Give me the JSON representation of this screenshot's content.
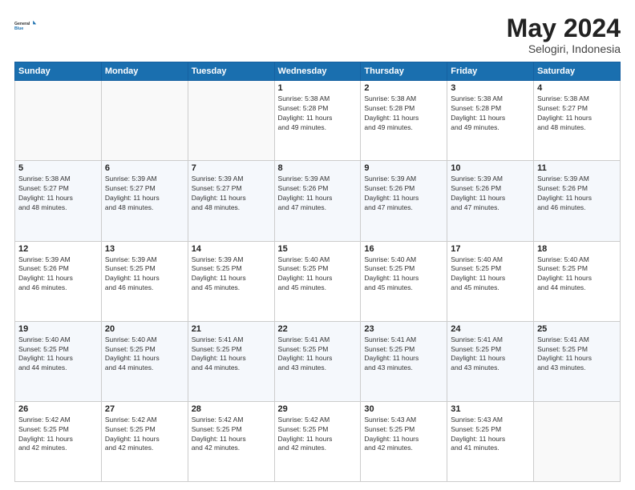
{
  "logo": {
    "line1": "General",
    "line2": "Blue"
  },
  "title": "May 2024",
  "subtitle": "Selogiri, Indonesia",
  "days_header": [
    "Sunday",
    "Monday",
    "Tuesday",
    "Wednesday",
    "Thursday",
    "Friday",
    "Saturday"
  ],
  "weeks": [
    [
      {
        "day": "",
        "content": ""
      },
      {
        "day": "",
        "content": ""
      },
      {
        "day": "",
        "content": ""
      },
      {
        "day": "1",
        "content": "Sunrise: 5:38 AM\nSunset: 5:28 PM\nDaylight: 11 hours\nand 49 minutes."
      },
      {
        "day": "2",
        "content": "Sunrise: 5:38 AM\nSunset: 5:28 PM\nDaylight: 11 hours\nand 49 minutes."
      },
      {
        "day": "3",
        "content": "Sunrise: 5:38 AM\nSunset: 5:28 PM\nDaylight: 11 hours\nand 49 minutes."
      },
      {
        "day": "4",
        "content": "Sunrise: 5:38 AM\nSunset: 5:27 PM\nDaylight: 11 hours\nand 48 minutes."
      }
    ],
    [
      {
        "day": "5",
        "content": "Sunrise: 5:38 AM\nSunset: 5:27 PM\nDaylight: 11 hours\nand 48 minutes."
      },
      {
        "day": "6",
        "content": "Sunrise: 5:39 AM\nSunset: 5:27 PM\nDaylight: 11 hours\nand 48 minutes."
      },
      {
        "day": "7",
        "content": "Sunrise: 5:39 AM\nSunset: 5:27 PM\nDaylight: 11 hours\nand 48 minutes."
      },
      {
        "day": "8",
        "content": "Sunrise: 5:39 AM\nSunset: 5:26 PM\nDaylight: 11 hours\nand 47 minutes."
      },
      {
        "day": "9",
        "content": "Sunrise: 5:39 AM\nSunset: 5:26 PM\nDaylight: 11 hours\nand 47 minutes."
      },
      {
        "day": "10",
        "content": "Sunrise: 5:39 AM\nSunset: 5:26 PM\nDaylight: 11 hours\nand 47 minutes."
      },
      {
        "day": "11",
        "content": "Sunrise: 5:39 AM\nSunset: 5:26 PM\nDaylight: 11 hours\nand 46 minutes."
      }
    ],
    [
      {
        "day": "12",
        "content": "Sunrise: 5:39 AM\nSunset: 5:26 PM\nDaylight: 11 hours\nand 46 minutes."
      },
      {
        "day": "13",
        "content": "Sunrise: 5:39 AM\nSunset: 5:25 PM\nDaylight: 11 hours\nand 46 minutes."
      },
      {
        "day": "14",
        "content": "Sunrise: 5:39 AM\nSunset: 5:25 PM\nDaylight: 11 hours\nand 45 minutes."
      },
      {
        "day": "15",
        "content": "Sunrise: 5:40 AM\nSunset: 5:25 PM\nDaylight: 11 hours\nand 45 minutes."
      },
      {
        "day": "16",
        "content": "Sunrise: 5:40 AM\nSunset: 5:25 PM\nDaylight: 11 hours\nand 45 minutes."
      },
      {
        "day": "17",
        "content": "Sunrise: 5:40 AM\nSunset: 5:25 PM\nDaylight: 11 hours\nand 45 minutes."
      },
      {
        "day": "18",
        "content": "Sunrise: 5:40 AM\nSunset: 5:25 PM\nDaylight: 11 hours\nand 44 minutes."
      }
    ],
    [
      {
        "day": "19",
        "content": "Sunrise: 5:40 AM\nSunset: 5:25 PM\nDaylight: 11 hours\nand 44 minutes."
      },
      {
        "day": "20",
        "content": "Sunrise: 5:40 AM\nSunset: 5:25 PM\nDaylight: 11 hours\nand 44 minutes."
      },
      {
        "day": "21",
        "content": "Sunrise: 5:41 AM\nSunset: 5:25 PM\nDaylight: 11 hours\nand 44 minutes."
      },
      {
        "day": "22",
        "content": "Sunrise: 5:41 AM\nSunset: 5:25 PM\nDaylight: 11 hours\nand 43 minutes."
      },
      {
        "day": "23",
        "content": "Sunrise: 5:41 AM\nSunset: 5:25 PM\nDaylight: 11 hours\nand 43 minutes."
      },
      {
        "day": "24",
        "content": "Sunrise: 5:41 AM\nSunset: 5:25 PM\nDaylight: 11 hours\nand 43 minutes."
      },
      {
        "day": "25",
        "content": "Sunrise: 5:41 AM\nSunset: 5:25 PM\nDaylight: 11 hours\nand 43 minutes."
      }
    ],
    [
      {
        "day": "26",
        "content": "Sunrise: 5:42 AM\nSunset: 5:25 PM\nDaylight: 11 hours\nand 42 minutes."
      },
      {
        "day": "27",
        "content": "Sunrise: 5:42 AM\nSunset: 5:25 PM\nDaylight: 11 hours\nand 42 minutes."
      },
      {
        "day": "28",
        "content": "Sunrise: 5:42 AM\nSunset: 5:25 PM\nDaylight: 11 hours\nand 42 minutes."
      },
      {
        "day": "29",
        "content": "Sunrise: 5:42 AM\nSunset: 5:25 PM\nDaylight: 11 hours\nand 42 minutes."
      },
      {
        "day": "30",
        "content": "Sunrise: 5:43 AM\nSunset: 5:25 PM\nDaylight: 11 hours\nand 42 minutes."
      },
      {
        "day": "31",
        "content": "Sunrise: 5:43 AM\nSunset: 5:25 PM\nDaylight: 11 hours\nand 41 minutes."
      },
      {
        "day": "",
        "content": ""
      }
    ]
  ]
}
